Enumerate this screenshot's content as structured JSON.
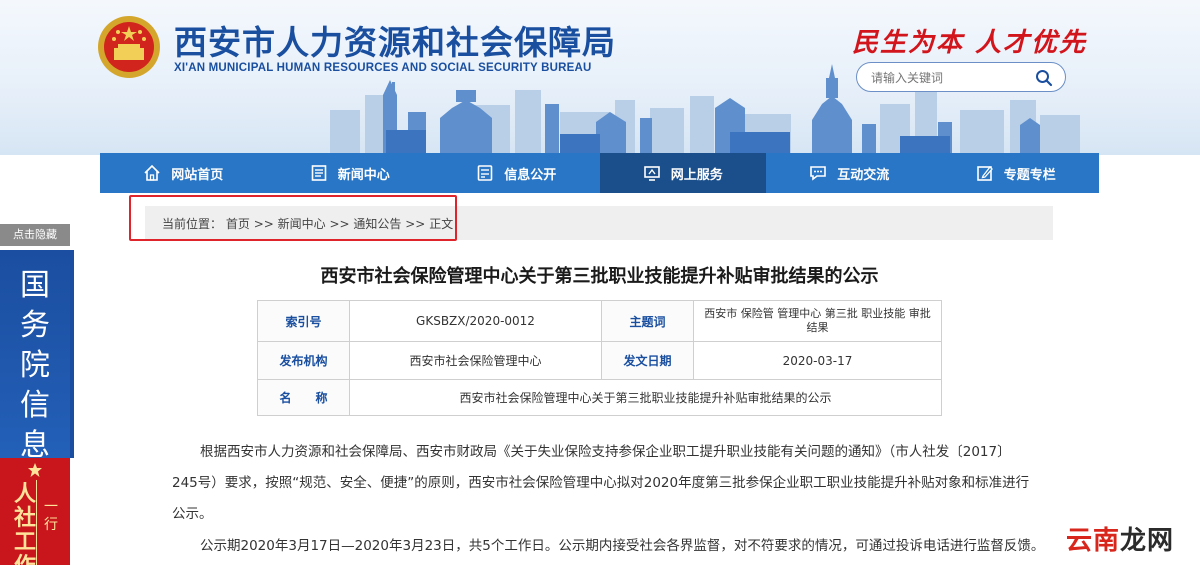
{
  "header": {
    "title": "西安市人力资源和社会保障局",
    "subtitle": "XI'AN MUNICIPAL HUMAN RESOURCES AND SOCIAL SECURITY BUREAU",
    "slogan": "民生为本 人才优先",
    "search_placeholder": "请输入关键词"
  },
  "nav": [
    {
      "label": "网站首页",
      "icon": "home-icon"
    },
    {
      "label": "新闻中心",
      "icon": "news-icon"
    },
    {
      "label": "信息公开",
      "icon": "info-icon"
    },
    {
      "label": "网上服务",
      "icon": "online-service-icon",
      "active": true
    },
    {
      "label": "互动交流",
      "icon": "chat-icon"
    },
    {
      "label": "专题专栏",
      "icon": "column-icon"
    }
  ],
  "breadcrumb": {
    "prefix": "当前位置：",
    "items": [
      "首页",
      "新闻中心",
      "通知公告",
      "正文"
    ],
    "separator": ">>"
  },
  "side": {
    "label": "点击隐藏",
    "gov_chars": [
      "国",
      "务",
      "院",
      "信",
      "息"
    ],
    "hr_col1": "人社工作",
    "hr_col2": "一行"
  },
  "article": {
    "title": "西安市社会保险管理中心关于第三批职业技能提升补贴审批结果的公示",
    "meta": {
      "index_label": "索引号",
      "index_value": "GKSBZX/2020-0012",
      "topic_label": "主题词",
      "topic_value": "西安市 保险管 管理中心 第三批 职业技能 审批 结果",
      "publisher_label": "发布机构",
      "publisher_value": "西安市社会保险管理中心",
      "date_label": "发文日期",
      "date_value": "2020-03-17",
      "name_label": "名　　称",
      "name_value": "西安市社会保险管理中心关于第三批职业技能提升补贴审批结果的公示"
    },
    "paragraph1": "根据西安市人力资源和社会保障局、西安市财政局《关于失业保险支持参保企业职工提升职业技能有关问题的通知》（市人社发〔2017〕245号）要求，按照“规范、安全、便捷”的原则，西安市社会保险管理中心拟对2020年度第三批参保企业职工职业技能提升补贴对象和标准进行公示。",
    "paragraph2": "公示期2020年3月17日—2020年3月23日，共5个工作日。公示期内接受社会各界监督，对不符要求的情况，可通过投诉电话进行监督反馈。"
  },
  "watermark": {
    "prefix": "云南",
    "suffix": "龙网"
  },
  "colors": {
    "primary_blue": "#1a4fa0",
    "nav_blue": "#2876c5",
    "nav_active": "#1a4f8c",
    "slogan_red": "#d2141c",
    "highlight_red": "#e0242b"
  }
}
